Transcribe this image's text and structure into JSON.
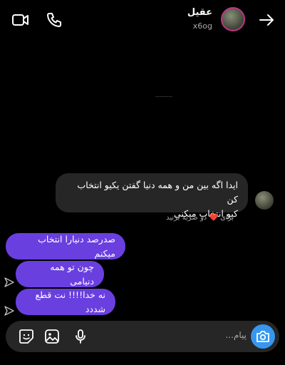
{
  "header": {
    "contact_name": "عقیل",
    "username": "x6og",
    "icons": [
      "back-arrow-icon",
      "video-call-icon",
      "phone-icon"
    ]
  },
  "messages": {
    "incoming": [
      {
        "text_line1": "ایدا اگه بین من و همه دنیا گفتن یکیو انتخاب کن",
        "text_line2": "کیو انتخاب میکنی"
      }
    ],
    "reaction_hint": "برای",
    "reaction_hint_rest": "دو ضربه بزنید",
    "outgoing": [
      {
        "text": "صدرصد دنیارا انتخاب میکنم"
      },
      {
        "text": "چون تو همه دنیامی"
      },
      {
        "text": "نه خدا!!!! نت قطع شددد"
      }
    ]
  },
  "composer": {
    "placeholder": "پیام..."
  },
  "colors": {
    "background": "#000000",
    "incoming_bubble": "#262626",
    "outgoing_bubble": "#6a3fe0",
    "camera_button": "#3797f0",
    "heart": "#ff3040"
  }
}
